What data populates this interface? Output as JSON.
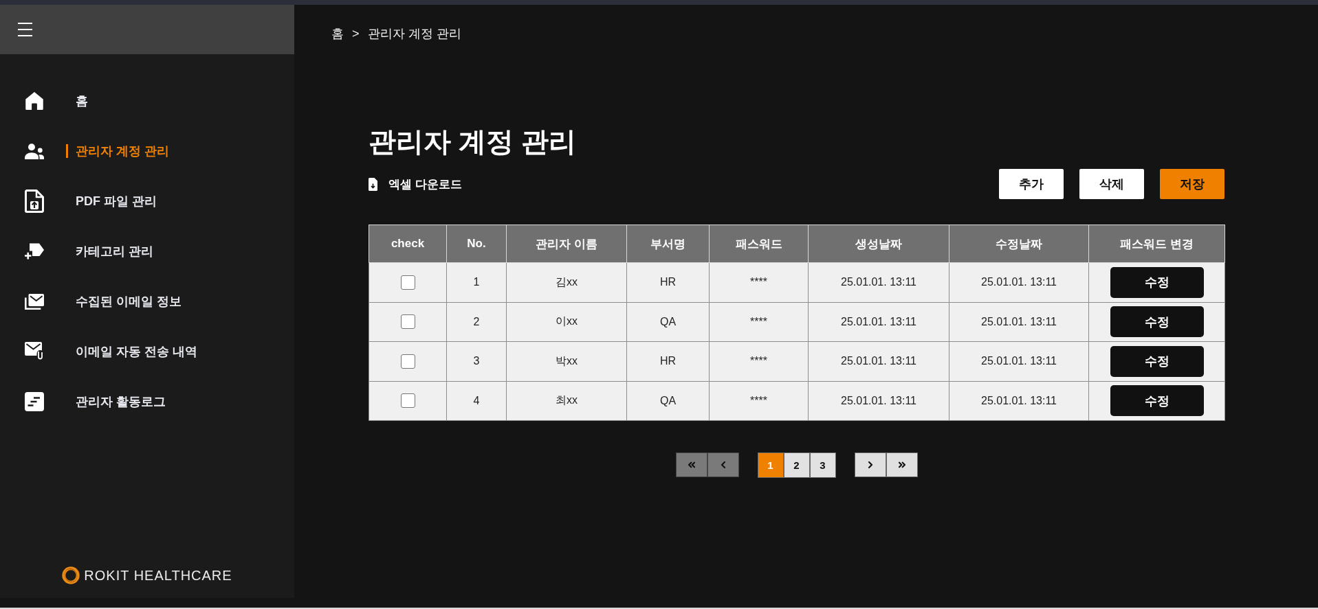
{
  "sidebar": {
    "items": [
      {
        "label": "홈",
        "selected": false
      },
      {
        "label": "관리자 계정 관리",
        "selected": true
      },
      {
        "label": "PDF 파일 관리",
        "selected": false
      },
      {
        "label": "카테고리 관리",
        "selected": false
      },
      {
        "label": "수집된 이메일 정보",
        "selected": false
      },
      {
        "label": "이메일 자동 전송 내역",
        "selected": false
      },
      {
        "label": "관리자 활동로그",
        "selected": false
      }
    ],
    "logo": "ROKIT HEALTHCARE"
  },
  "breadcrumb": {
    "items": [
      "홈",
      "관리자 계정 관리"
    ],
    "separator": ">"
  },
  "page_title": "관리자 계정 관리",
  "excel_download": "엑셀 다운로드",
  "actions": [
    {
      "label": "추가",
      "kind": "default"
    },
    {
      "label": "삭제",
      "kind": "default"
    },
    {
      "label": "저장",
      "kind": "primary"
    }
  ],
  "table": {
    "columns": [
      "check",
      "No.",
      "관리자 이름",
      "부서명",
      "패스워드",
      "생성날짜",
      "수정날짜",
      "패스워드 변경"
    ],
    "rows": [
      {
        "checked": false,
        "no": "1",
        "name": "김xx",
        "department": "HR",
        "password": "****",
        "created": "25.01.01. 13:11",
        "modified": "25.01.01. 13:11",
        "action": "수정"
      },
      {
        "checked": false,
        "no": "2",
        "name": "이xx",
        "department": "QA",
        "password": "****",
        "created": "25.01.01. 13:11",
        "modified": "25.01.01. 13:11",
        "action": "수정"
      },
      {
        "checked": false,
        "no": "3",
        "name": "박xx",
        "department": "HR",
        "password": "****",
        "created": "25.01.01. 13:11",
        "modified": "25.01.01. 13:11",
        "action": "수정"
      },
      {
        "checked": false,
        "no": "4",
        "name": "최xx",
        "department": "QA",
        "password": "****",
        "created": "25.01.01. 13:11",
        "modified": "25.01.01. 13:11",
        "action": "수정"
      }
    ]
  },
  "pagination": {
    "nav_before": [
      {
        "kind": "first",
        "disabled": true
      },
      {
        "kind": "prev",
        "disabled": true
      }
    ],
    "pages": [
      {
        "label": "1",
        "selected": true
      },
      {
        "label": "2",
        "selected": false
      },
      {
        "label": "3",
        "selected": false
      }
    ],
    "nav_after": [
      {
        "kind": "next",
        "disabled": false
      },
      {
        "kind": "last",
        "disabled": false
      }
    ]
  }
}
